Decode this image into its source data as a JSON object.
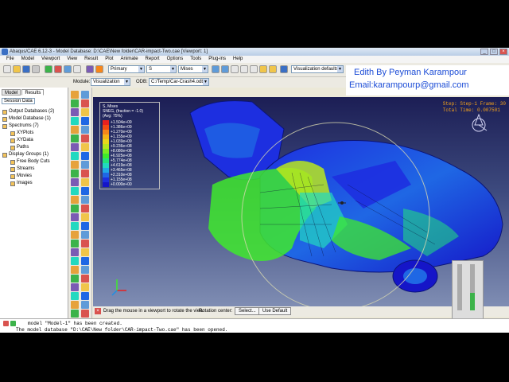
{
  "window": {
    "title": "Abaqus/CAE 6.12-3 - Model Database: D:\\CAE\\New folder\\CAR-impact-Two.cae [Viewport: 1]"
  },
  "menu": [
    "File",
    "Model",
    "Viewport",
    "View",
    "Result",
    "Plot",
    "Animate",
    "Report",
    "Options",
    "Tools",
    "Plug-ins",
    "Help"
  ],
  "toolbar": {
    "primary_select": "Primary",
    "s_select": "S",
    "mises_select": "Mises",
    "viz_defaults": "Visualization defaults"
  },
  "context_bar": {
    "module_label": "Module:",
    "module_value": "Visualization",
    "odb_label": "ODB:",
    "odb_value": "C:/Temp/Car-Crash4.odb"
  },
  "overlay": {
    "line1": "Edith By Peyman Karampour",
    "line2": "Email:karampourp@gmail.com"
  },
  "left_panel": {
    "tabs": [
      "Model",
      "Results"
    ],
    "active_tab": "Results",
    "session_label": "Session Data",
    "tree": [
      {
        "label": "Output Databases (2)",
        "indent": 0
      },
      {
        "label": "Model Database (1)",
        "indent": 0
      },
      {
        "label": "Spectrums (7)",
        "indent": 0
      },
      {
        "label": "XYPlots",
        "indent": 1
      },
      {
        "label": "XYData",
        "indent": 1
      },
      {
        "label": "Paths",
        "indent": 1
      },
      {
        "label": "Display Groups (1)",
        "indent": 0
      },
      {
        "label": "Free Body Cuts",
        "indent": 1
      },
      {
        "label": "Streams",
        "indent": 1
      },
      {
        "label": "Movies",
        "indent": 1
      },
      {
        "label": "Images",
        "indent": 1
      }
    ]
  },
  "legend": {
    "title": "S, Mises",
    "subtitle": "SNEG, (fraction = -1.0)",
    "avg": "(Avg: 75%)",
    "entries": [
      {
        "value": "+1.504e+09",
        "color": "#e8201f"
      },
      {
        "value": "+1.386e+09",
        "color": "#f34b12"
      },
      {
        "value": "+1.270e+09",
        "color": "#f7861a"
      },
      {
        "value": "+1.155e+09",
        "color": "#f6b318"
      },
      {
        "value": "+1.039e+09",
        "color": "#e8d81b"
      },
      {
        "value": "+9.236e+08",
        "color": "#b8e61f"
      },
      {
        "value": "+8.080e+08",
        "color": "#7ceb23"
      },
      {
        "value": "+6.925e+08",
        "color": "#3fe92d"
      },
      {
        "value": "+5.774e+08",
        "color": "#23e37b"
      },
      {
        "value": "+4.619e+08",
        "color": "#22d9c0"
      },
      {
        "value": "+3.465e+08",
        "color": "#21a8e6"
      },
      {
        "value": "+2.310e+08",
        "color": "#1f67e4"
      },
      {
        "value": "+1.155e+08",
        "color": "#1d2fe0"
      },
      {
        "value": "+0.000e+00",
        "color": "#1515c8"
      }
    ]
  },
  "step_info": {
    "line1": "Step: Step-1    Frame: 30",
    "line2": "Total Time: 0.007501"
  },
  "status": {
    "message": "Drag the mouse in a viewport to rotate the view",
    "rotation_center": "Rotation center:",
    "select_btn": "Select...",
    "default_btn": "Use Default"
  },
  "messages": {
    "line1": "model \"Model-1\" has been created.",
    "line2": "The model database \"D:\\CAE\\New folder\\CAR-impact-Two.cae\" has been opened."
  },
  "colors": {
    "accent": "#1a4bd6",
    "step_text": "#f5a31b"
  }
}
